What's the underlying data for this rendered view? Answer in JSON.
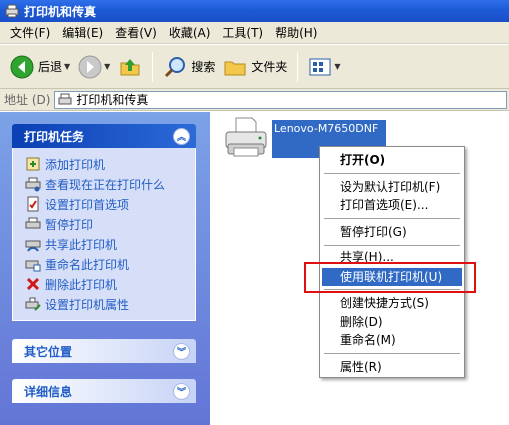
{
  "window": {
    "title": "打印机和传真"
  },
  "menubar": {
    "items": [
      "文件(F)",
      "编辑(E)",
      "查看(V)",
      "收藏(A)",
      "工具(T)",
      "帮助(H)"
    ]
  },
  "toolbar": {
    "back": "后退",
    "search": "搜索",
    "folders": "文件夹"
  },
  "address": {
    "label": "地址 (D)",
    "value": "打印机和传真"
  },
  "tasks_panel": {
    "title": "打印机任务",
    "items": [
      "添加打印机",
      "查看现在正在打印什么",
      "设置打印首选项",
      "暂停打印",
      "共享此打印机",
      "重命名此打印机",
      "删除此打印机",
      "设置打印机属性"
    ]
  },
  "other_places": {
    "title": "其它位置"
  },
  "details": {
    "title": "详细信息"
  },
  "printer": {
    "name": "Lenovo-M7650DNF"
  },
  "context_menu": {
    "items": [
      "打开(O)",
      "设为默认打印机(F)",
      "打印首选项(E)...",
      "暂停打印(G)",
      "共享(H)...",
      "使用联机打印机(U)",
      "创建快捷方式(S)",
      "删除(D)",
      "重命名(M)",
      "属性(R)"
    ],
    "highlighted": "使用联机打印机(U)"
  },
  "colors": {
    "highlight": "#316ac5",
    "annotation": "#e01010"
  }
}
